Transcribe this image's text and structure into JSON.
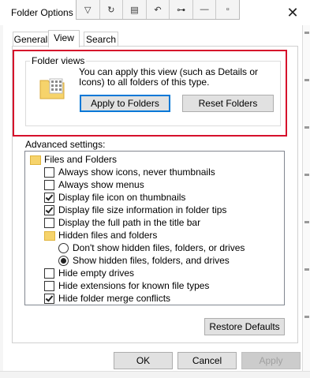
{
  "window": {
    "title": "Folder Options",
    "close_glyph": "✕"
  },
  "quick_toolbar": [
    {
      "icon": "collapse-icon",
      "glyph": "▽"
    },
    {
      "icon": "rotate-icon",
      "glyph": "↻"
    },
    {
      "icon": "save-icon",
      "glyph": "▤"
    },
    {
      "icon": "undo-icon",
      "glyph": "↶"
    },
    {
      "icon": "connect-icon",
      "glyph": "⊶"
    },
    {
      "icon": "minimize-icon",
      "glyph": "—"
    },
    {
      "icon": "restore-icon",
      "glyph": "▫"
    }
  ],
  "tabs": [
    "General",
    "View",
    "Search"
  ],
  "folder_views": {
    "group_label": "Folder views",
    "description": "You can apply this view (such as Details or Icons) to all folders of this type.",
    "apply_button": "Apply to Folders",
    "reset_button": "Reset Folders"
  },
  "advanced": {
    "label": "Advanced settings:",
    "items": [
      {
        "type": "folder",
        "label": "Files and Folders",
        "indent": 0
      },
      {
        "type": "checkbox",
        "label": "Always show icons, never thumbnails",
        "checked": false,
        "indent": 1
      },
      {
        "type": "checkbox",
        "label": "Always show menus",
        "checked": false,
        "indent": 1
      },
      {
        "type": "checkbox",
        "label": "Display file icon on thumbnails",
        "checked": true,
        "indent": 1
      },
      {
        "type": "checkbox",
        "label": "Display file size information in folder tips",
        "checked": true,
        "indent": 1
      },
      {
        "type": "checkbox",
        "label": "Display the full path in the title bar",
        "checked": false,
        "indent": 1
      },
      {
        "type": "folder",
        "label": "Hidden files and folders",
        "indent": 1
      },
      {
        "type": "radio",
        "label": "Don't show hidden files, folders, or drives",
        "checked": false,
        "indent": 2
      },
      {
        "type": "radio",
        "label": "Show hidden files, folders, and drives",
        "checked": true,
        "indent": 2
      },
      {
        "type": "checkbox",
        "label": "Hide empty drives",
        "checked": false,
        "indent": 1
      },
      {
        "type": "checkbox",
        "label": "Hide extensions for known file types",
        "checked": false,
        "indent": 1
      },
      {
        "type": "checkbox",
        "label": "Hide folder merge conflicts",
        "checked": true,
        "indent": 1
      }
    ],
    "restore_button": "Restore Defaults"
  },
  "footer": {
    "ok": "OK",
    "cancel": "Cancel",
    "apply": "Apply"
  },
  "colors": {
    "highlight_border": "#d6102b",
    "default_button": "#0078d7"
  }
}
